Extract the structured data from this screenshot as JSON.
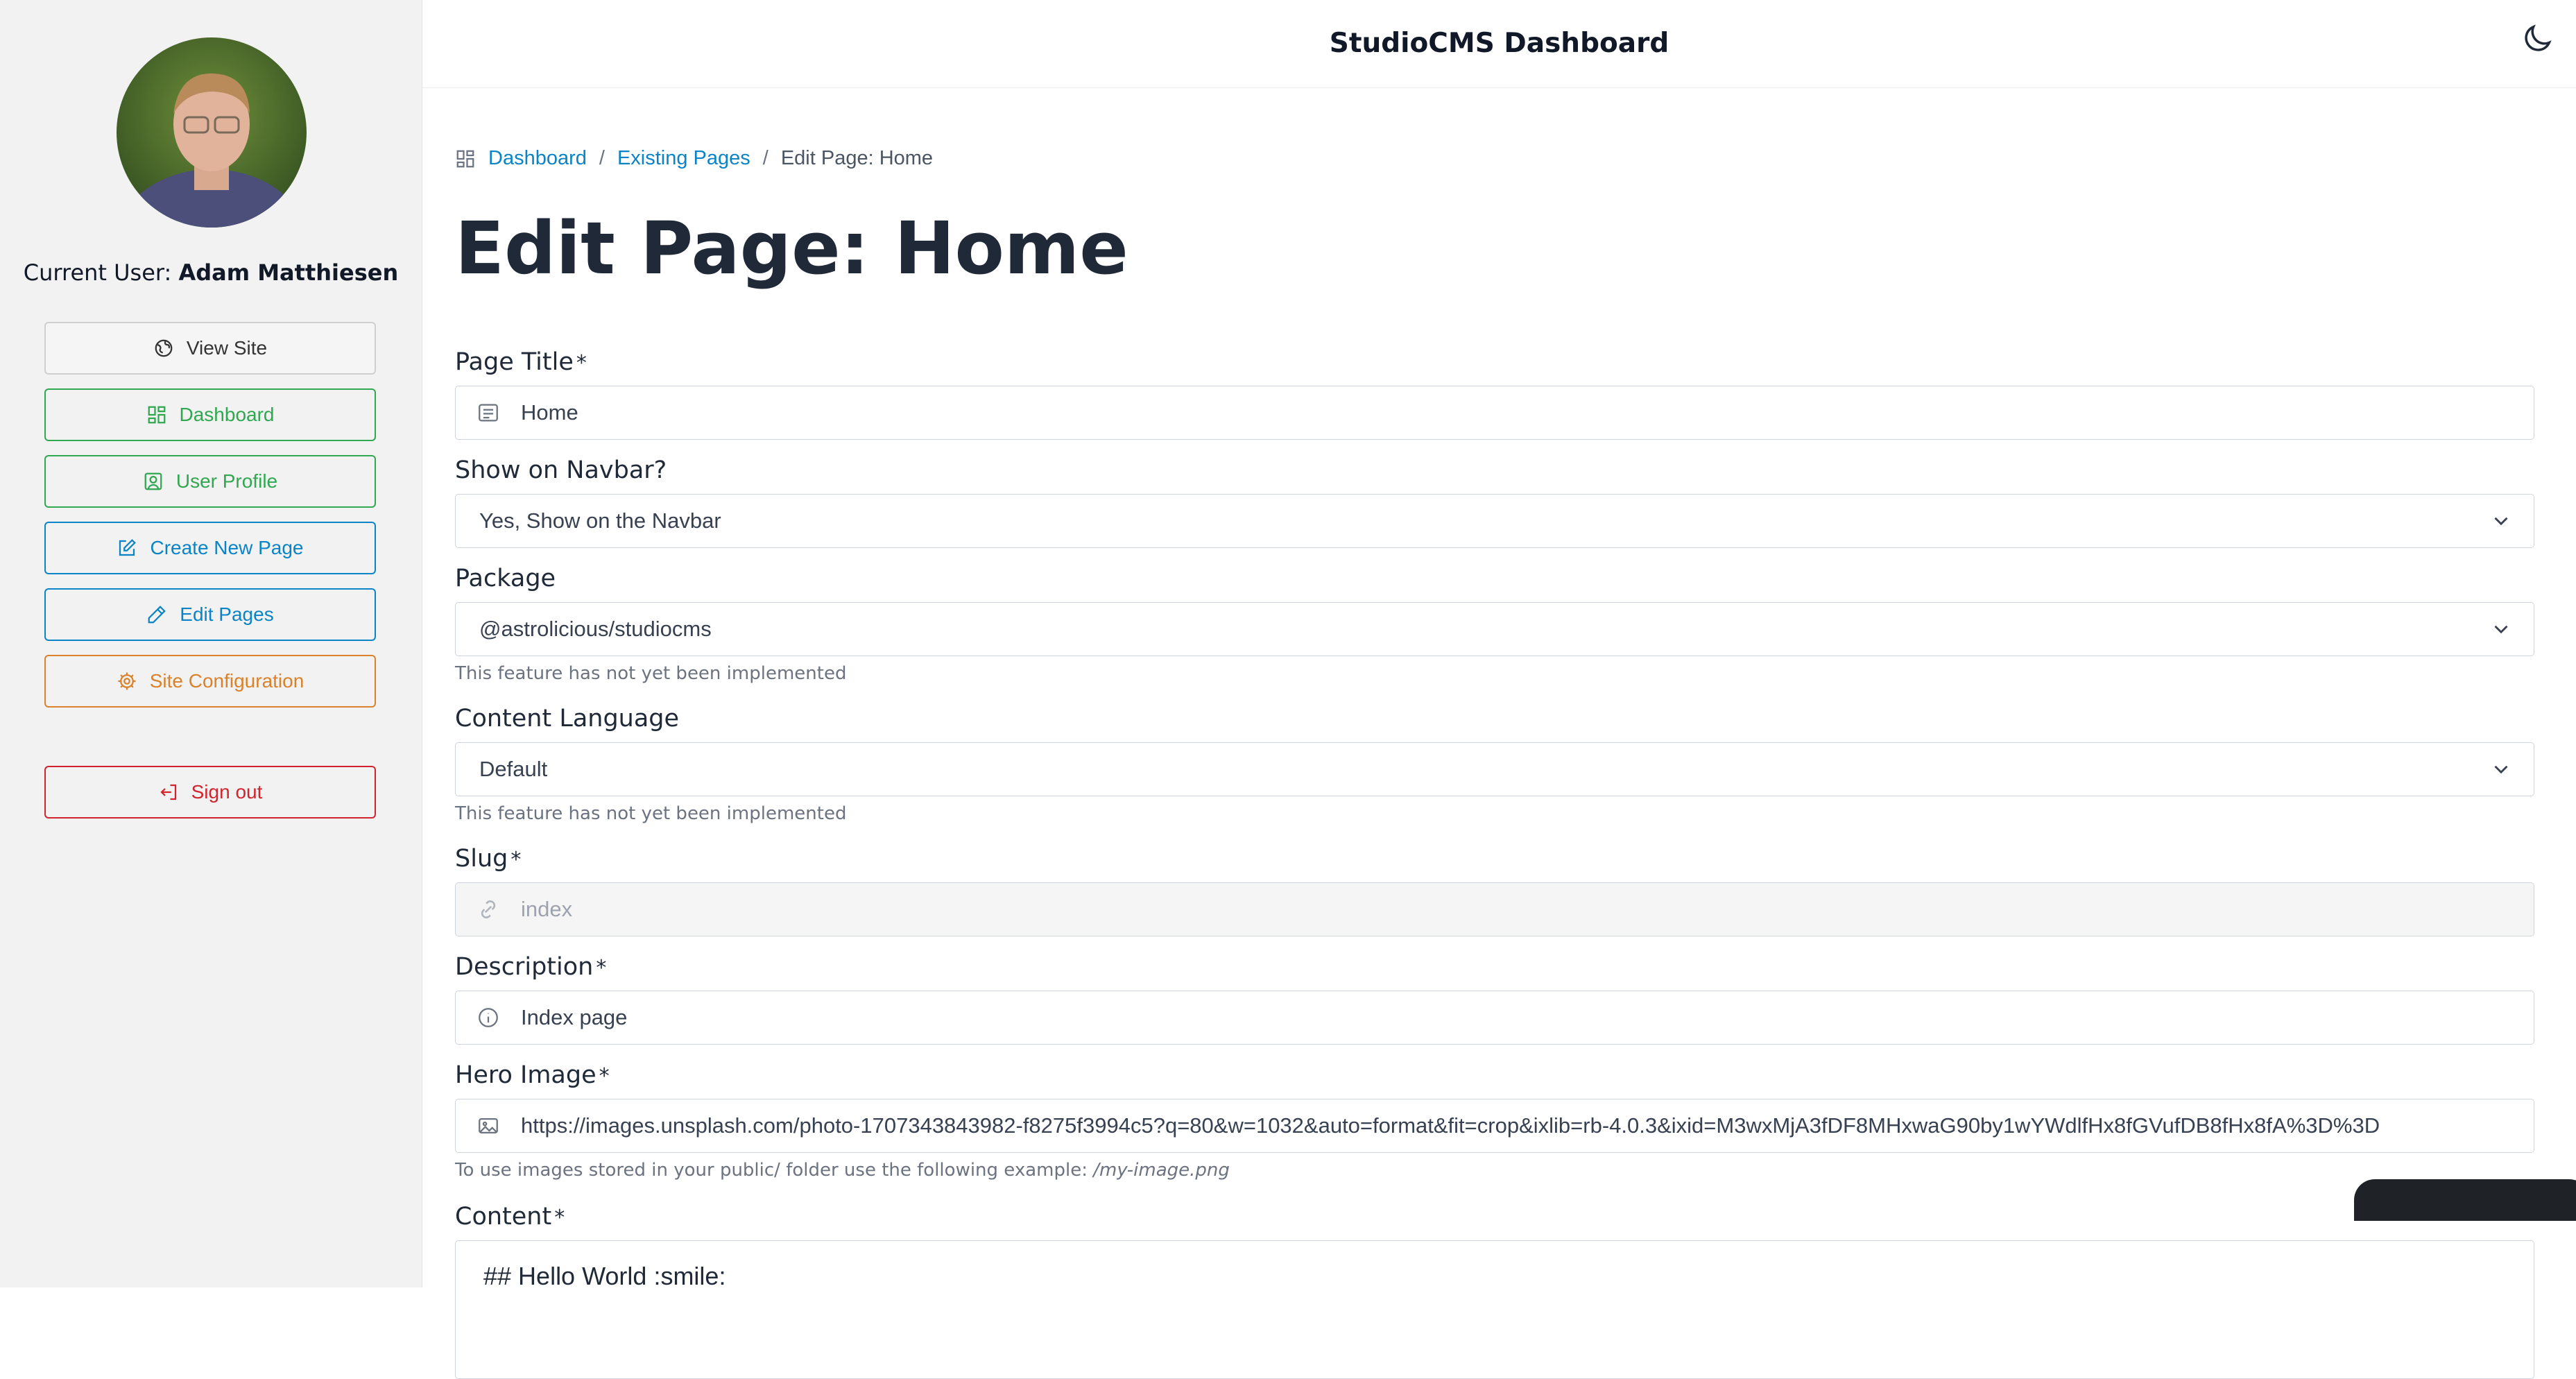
{
  "sidebar": {
    "current_user_prefix": "Current User:",
    "current_user_name": "Adam Matthiesen",
    "buttons": {
      "view_site": "View Site",
      "dashboard": "Dashboard",
      "user_profile": "User Profile",
      "create_new_page": "Create New Page",
      "edit_pages": "Edit Pages",
      "site_configuration": "Site Configuration",
      "sign_out": "Sign out"
    }
  },
  "header": {
    "title": "StudioCMS Dashboard"
  },
  "breadcrumb": {
    "dashboard": "Dashboard",
    "existing_pages": "Existing Pages",
    "current": "Edit Page: Home"
  },
  "page": {
    "title": "Edit Page: Home"
  },
  "form": {
    "page_title": {
      "label": "Page Title",
      "value": "Home"
    },
    "show_on_navbar": {
      "label": "Show on Navbar?",
      "value": "Yes, Show on the Navbar"
    },
    "package": {
      "label": "Package",
      "value": "@astrolicious/studiocms",
      "hint": "This feature has not yet been implemented"
    },
    "content_language": {
      "label": "Content Language",
      "value": "Default",
      "hint": "This feature has not yet been implemented"
    },
    "slug": {
      "label": "Slug",
      "value": "index"
    },
    "description": {
      "label": "Description",
      "value": "Index page"
    },
    "hero_image": {
      "label": "Hero Image",
      "value": "https://images.unsplash.com/photo-1707343843982-f8275f3994c5?q=80&w=1032&auto=format&fit=crop&ixlib=rb-4.0.3&ixid=M3wxMjA3fDF8MHxwaG90by1wYWdlfHx8fGVufDB8fHx8fA%3D%3D",
      "hint_prefix": "To use images stored in your public/ folder use the following example:",
      "hint_example": "/my-image.png"
    },
    "content": {
      "label": "Content",
      "value": "## Hello World :smile:"
    },
    "required_mark": "*"
  },
  "colors": {
    "green": "#2fa84f",
    "blue": "#0a84c6",
    "orange": "#d9822b",
    "red": "#d1242f"
  }
}
